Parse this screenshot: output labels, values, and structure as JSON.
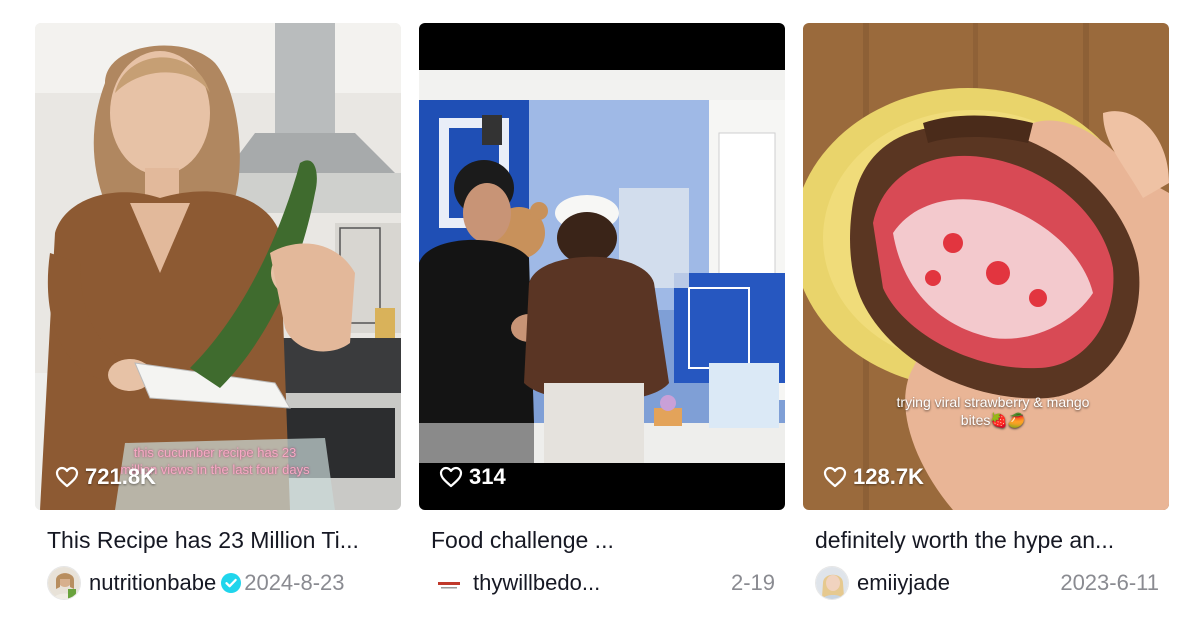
{
  "videos": [
    {
      "likes": "721.8K",
      "overlay_text": "this cucumber recipe has 23 million views in the last four days",
      "title": "This Recipe has 23 Million Ti...",
      "username": "nutritionbabe",
      "verified": true,
      "date": "2024-8-23"
    },
    {
      "likes": "314",
      "title": "Food challenge ...",
      "username": "thywillbedo...",
      "verified": false,
      "date": "2-19"
    },
    {
      "likes": "128.7K",
      "overlay_text": "trying viral strawberry & mango bites🍓🥭",
      "title": "definitely worth the hype an...",
      "username": "emiiyjade",
      "verified": false,
      "date": "2023-6-11"
    }
  ],
  "icons": {
    "likes": "heart-outline-icon",
    "verified": "verified-badge-icon"
  },
  "colors": {
    "verified_badge": "#20d5ec",
    "date_text": "#8a8b91",
    "overlay_pink": "#f7a9c5"
  }
}
